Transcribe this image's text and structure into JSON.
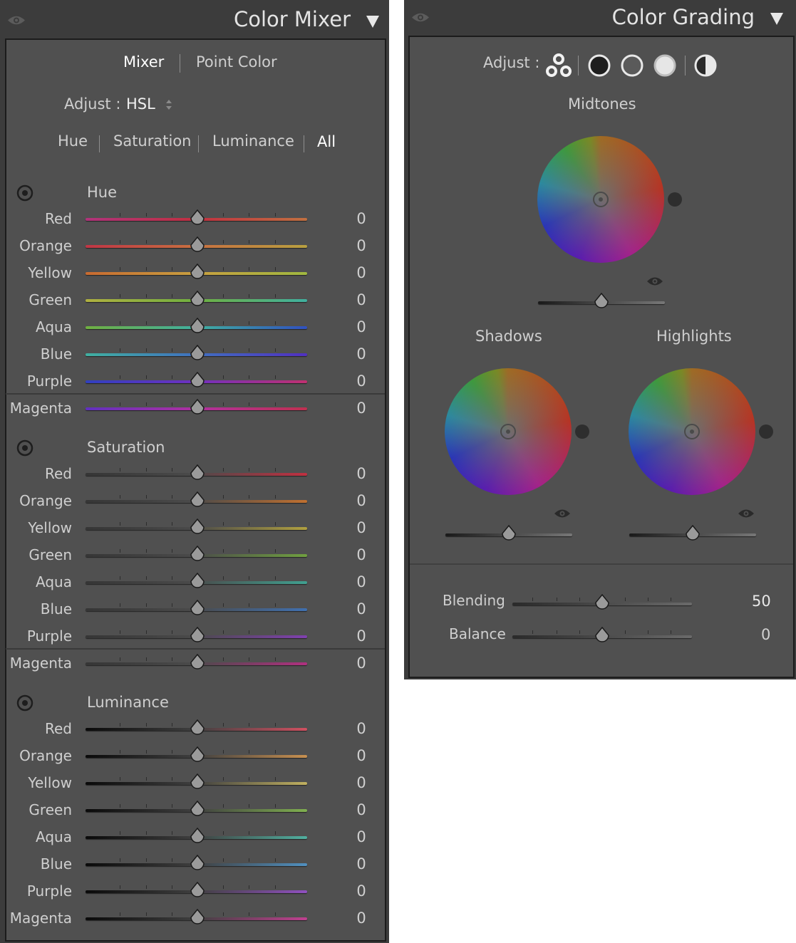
{
  "color_mixer": {
    "title": "Color Mixer",
    "tabs": [
      "Mixer",
      "Point Color"
    ],
    "adjust_label": "Adjust :",
    "adjust_value": "HSL",
    "filters": [
      "Hue",
      "Saturation",
      "Luminance",
      "All"
    ],
    "sections": [
      {
        "title": "Hue",
        "rows": [
          {
            "label": "Red",
            "value": "0"
          },
          {
            "label": "Orange",
            "value": "0"
          },
          {
            "label": "Yellow",
            "value": "0"
          },
          {
            "label": "Green",
            "value": "0"
          },
          {
            "label": "Aqua",
            "value": "0"
          },
          {
            "label": "Blue",
            "value": "0"
          },
          {
            "label": "Purple",
            "value": "0"
          },
          {
            "label": "Magenta",
            "value": "0"
          }
        ]
      },
      {
        "title": "Saturation",
        "rows": [
          {
            "label": "Red",
            "value": "0"
          },
          {
            "label": "Orange",
            "value": "0"
          },
          {
            "label": "Yellow",
            "value": "0"
          },
          {
            "label": "Green",
            "value": "0"
          },
          {
            "label": "Aqua",
            "value": "0"
          },
          {
            "label": "Blue",
            "value": "0"
          },
          {
            "label": "Purple",
            "value": "0"
          },
          {
            "label": "Magenta",
            "value": "0"
          }
        ]
      },
      {
        "title": "Luminance",
        "rows": [
          {
            "label": "Red",
            "value": "0"
          },
          {
            "label": "Orange",
            "value": "0"
          },
          {
            "label": "Yellow",
            "value": "0"
          },
          {
            "label": "Green",
            "value": "0"
          },
          {
            "label": "Aqua",
            "value": "0"
          },
          {
            "label": "Blue",
            "value": "0"
          },
          {
            "label": "Purple",
            "value": "0"
          },
          {
            "label": "Magenta",
            "value": "0"
          }
        ]
      }
    ]
  },
  "color_grading": {
    "title": "Color Grading",
    "adjust_label": "Adjust :",
    "wheels": {
      "midtones": "Midtones",
      "shadows": "Shadows",
      "highlights": "Highlights"
    },
    "blending": {
      "label": "Blending",
      "value": "50"
    },
    "balance": {
      "label": "Balance",
      "value": "0"
    }
  },
  "colors": {
    "panel_bg": "#3c3c3c",
    "inner_bg": "#505050",
    "text": "#d6d6d6",
    "active_text": "#ffffff"
  }
}
